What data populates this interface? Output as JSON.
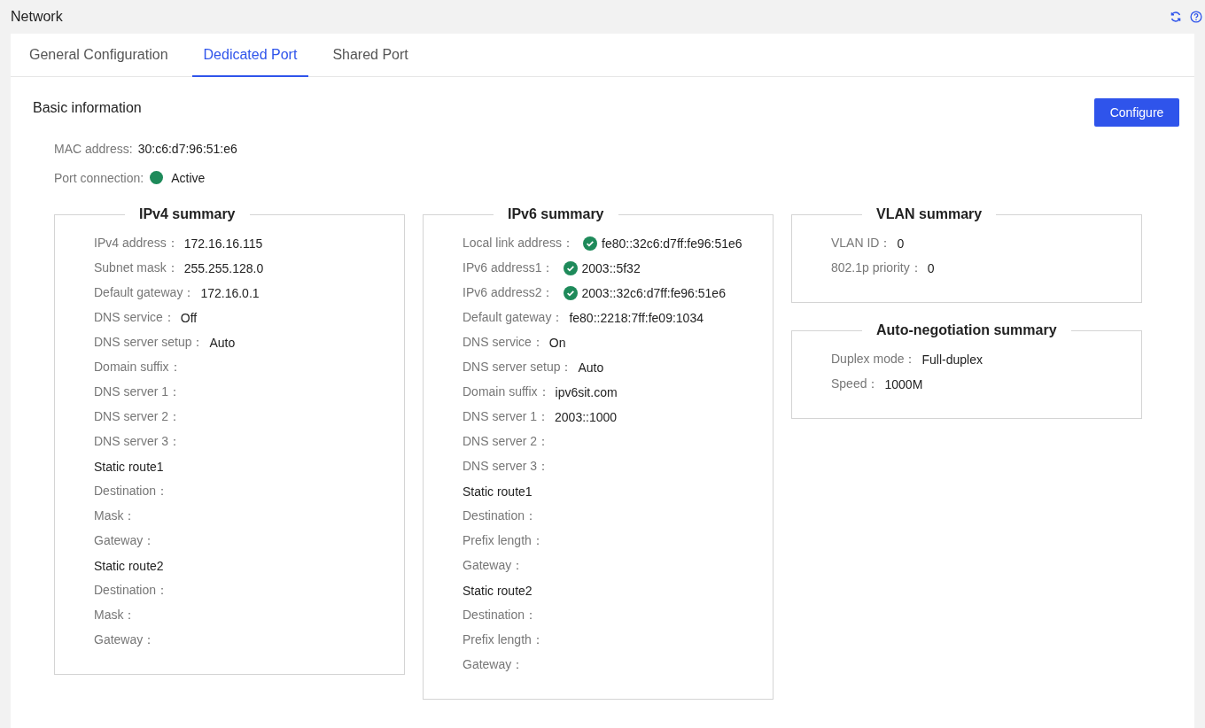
{
  "page_title": "Network",
  "tabs": [
    {
      "label": "General Configuration",
      "selected": false
    },
    {
      "label": "Dedicated Port",
      "selected": true
    },
    {
      "label": "Shared Port",
      "selected": false
    }
  ],
  "section_title": "Basic information",
  "configure_button": "Configure",
  "mac": {
    "label": "MAC address:",
    "value": "30:c6:d7:96:51:e6"
  },
  "port_connection": {
    "label": "Port connection:",
    "value": "Active",
    "active": true
  },
  "columns": [
    [
      {
        "title": "IPv4 summary",
        "rows": [
          {
            "kind": "field",
            "label": "IPv4 address：",
            "value": "172.16.16.115"
          },
          {
            "kind": "field",
            "label": "Subnet mask：",
            "value": "255.255.128.0"
          },
          {
            "kind": "field",
            "label": "Default gateway：",
            "value": "172.16.0.1"
          },
          {
            "kind": "field",
            "label": "DNS service：",
            "value": "Off"
          },
          {
            "kind": "field",
            "label": "DNS server setup：",
            "value": "Auto"
          },
          {
            "kind": "field",
            "label": "Domain suffix："
          },
          {
            "kind": "field",
            "label": "DNS server 1："
          },
          {
            "kind": "field",
            "label": "DNS server 2："
          },
          {
            "kind": "field",
            "label": "DNS server 3："
          },
          {
            "kind": "heading",
            "label": "Static route1"
          },
          {
            "kind": "field",
            "label": "Destination："
          },
          {
            "kind": "field",
            "label": "Mask："
          },
          {
            "kind": "field",
            "label": "Gateway："
          },
          {
            "kind": "heading",
            "label": "Static route2"
          },
          {
            "kind": "field",
            "label": "Destination："
          },
          {
            "kind": "field",
            "label": "Mask："
          },
          {
            "kind": "field",
            "label": "Gateway："
          }
        ]
      }
    ],
    [
      {
        "title": "IPv6 summary",
        "rows": [
          {
            "kind": "verified",
            "label": "Local link address：",
            "value": "fe80::32c6:d7ff:fe96:51e6"
          },
          {
            "kind": "verified",
            "label": "IPv6 address1：",
            "value": "2003::5f32"
          },
          {
            "kind": "verified",
            "label": "IPv6 address2：",
            "value": "2003::32c6:d7ff:fe96:51e6"
          },
          {
            "kind": "field",
            "label": "Default gateway：",
            "value": "fe80::2218:7ff:fe09:1034"
          },
          {
            "kind": "field",
            "label": "DNS service：",
            "value": "On"
          },
          {
            "kind": "field",
            "label": "DNS server setup：",
            "value": "Auto"
          },
          {
            "kind": "field",
            "label": "Domain suffix：",
            "value": "ipv6sit.com"
          },
          {
            "kind": "field",
            "label": "DNS server 1：",
            "value": "2003::1000"
          },
          {
            "kind": "field",
            "label": "DNS server 2："
          },
          {
            "kind": "field",
            "label": "DNS server 3："
          },
          {
            "kind": "heading",
            "label": "Static route1"
          },
          {
            "kind": "field",
            "label": "Destination："
          },
          {
            "kind": "field",
            "label": "Prefix length："
          },
          {
            "kind": "field",
            "label": "Gateway："
          },
          {
            "kind": "heading",
            "label": "Static route2"
          },
          {
            "kind": "field",
            "label": "Destination："
          },
          {
            "kind": "field",
            "label": "Prefix length："
          },
          {
            "kind": "field",
            "label": "Gateway："
          }
        ]
      }
    ],
    [
      {
        "title": "VLAN summary",
        "rows": [
          {
            "kind": "field",
            "label": "VLAN ID：",
            "value": "0"
          },
          {
            "kind": "field",
            "label": "802.1p priority：",
            "value": "0"
          }
        ]
      },
      {
        "title": "Auto-negotiation summary",
        "rows": [
          {
            "kind": "field",
            "label": "Duplex mode：",
            "value": "Full-duplex"
          },
          {
            "kind": "field",
            "label": "Speed：",
            "value": "1000M"
          }
        ]
      }
    ]
  ]
}
